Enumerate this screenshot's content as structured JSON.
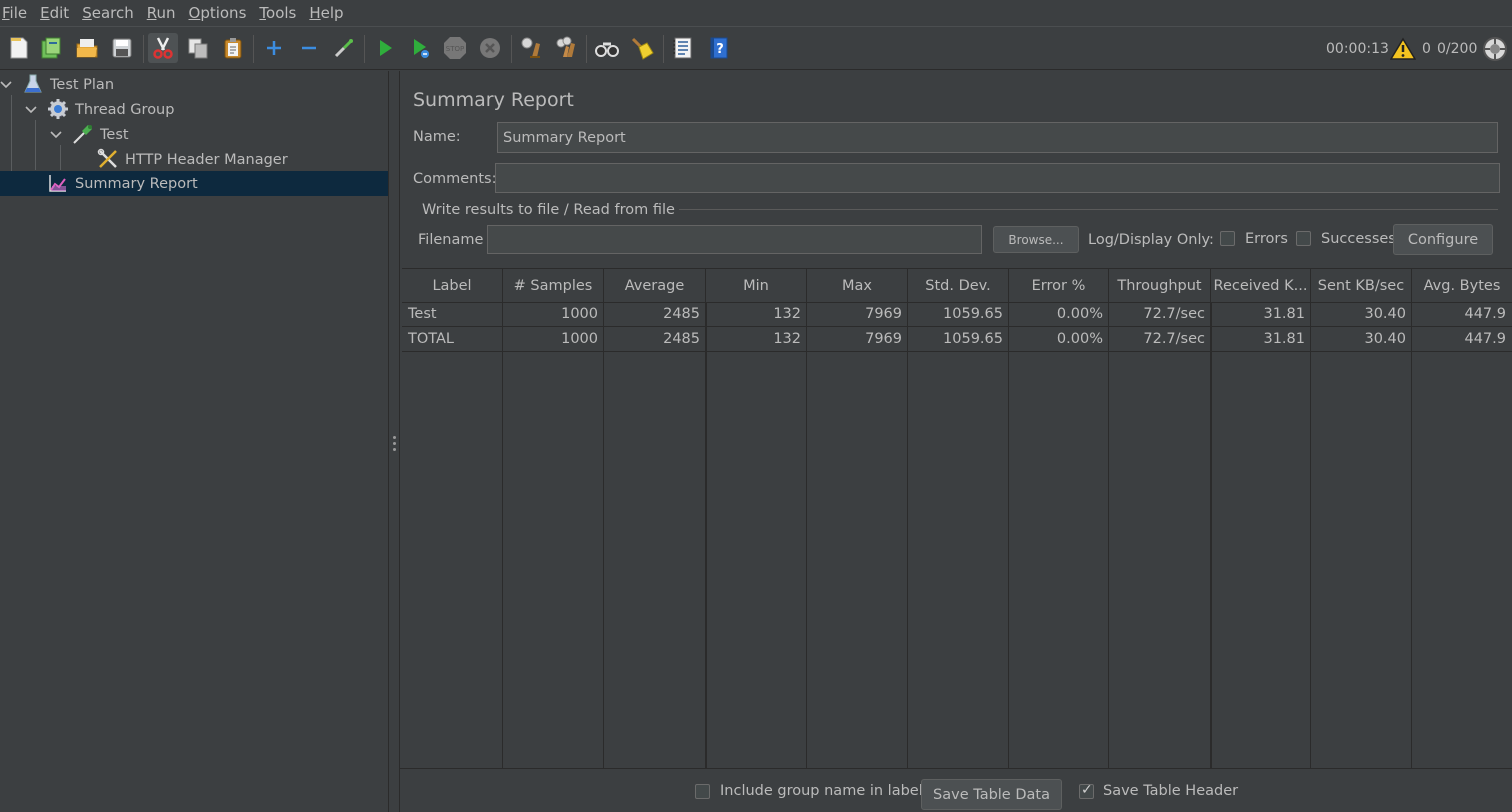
{
  "menu": [
    {
      "mn": "F",
      "rest": "ile"
    },
    {
      "mn": "E",
      "rest": "dit"
    },
    {
      "mn": "S",
      "rest": "earch"
    },
    {
      "mn": "R",
      "rest": "un"
    },
    {
      "mn": "O",
      "rest": "ptions"
    },
    {
      "mn": "T",
      "rest": "ools"
    },
    {
      "mn": "H",
      "rest": "elp"
    }
  ],
  "toolbar": {
    "icons": [
      "new-icon",
      "templates-icon",
      "open-icon",
      "save-icon",
      "cut-icon",
      "copy-icon",
      "paste-icon",
      "expand-icon",
      "collapse-icon",
      "toggle-icon",
      "start-icon",
      "start-no-pause-icon",
      "stop-icon",
      "shutdown-icon",
      "clear-icon",
      "clear-all-icon",
      "search-icon",
      "reset-search-icon",
      "function-helper-icon",
      "help-icon"
    ],
    "elapsed": "00:00:13",
    "warnings": "0",
    "threads": "0/200"
  },
  "tree": [
    {
      "label": "Test Plan",
      "icon": "flask-icon"
    },
    {
      "label": "Thread Group",
      "icon": "gear-icon"
    },
    {
      "label": "Test",
      "icon": "pipette-icon"
    },
    {
      "label": "HTTP Header Manager",
      "icon": "tools-icon"
    },
    {
      "label": "Summary Report",
      "icon": "chart-icon"
    }
  ],
  "panel": {
    "title": "Summary Report",
    "name_label": "Name:",
    "name_value": "Summary Report",
    "comments_label": "Comments:",
    "comments_value": "",
    "file_group_title": "Write results to file / Read from file",
    "filename_label": "Filename",
    "filename_value": "",
    "browse_label": "Browse...",
    "log_display_label": "Log/Display Only:",
    "errors_label": "Errors",
    "successes_label": "Successes",
    "configure_label": "Configure"
  },
  "table": {
    "headers": [
      "Label",
      "# Samples",
      "Average",
      "Min",
      "Max",
      "Std. Dev.",
      "Error %",
      "Throughput",
      "Received K...",
      "Sent KB/sec",
      "Avg. Bytes"
    ],
    "rows": [
      [
        "Test",
        "1000",
        "2485",
        "132",
        "7969",
        "1059.65",
        "0.00%",
        "72.7/sec",
        "31.81",
        "30.40",
        "447.9"
      ],
      [
        "TOTAL",
        "1000",
        "2485",
        "132",
        "7969",
        "1059.65",
        "0.00%",
        "72.7/sec",
        "31.81",
        "30.40",
        "447.9"
      ]
    ]
  },
  "footer": {
    "include_group_label": "Include group name in label?",
    "save_table_data_label": "Save Table Data",
    "save_table_header_label": "Save Table Header",
    "save_table_header_checked": true
  }
}
